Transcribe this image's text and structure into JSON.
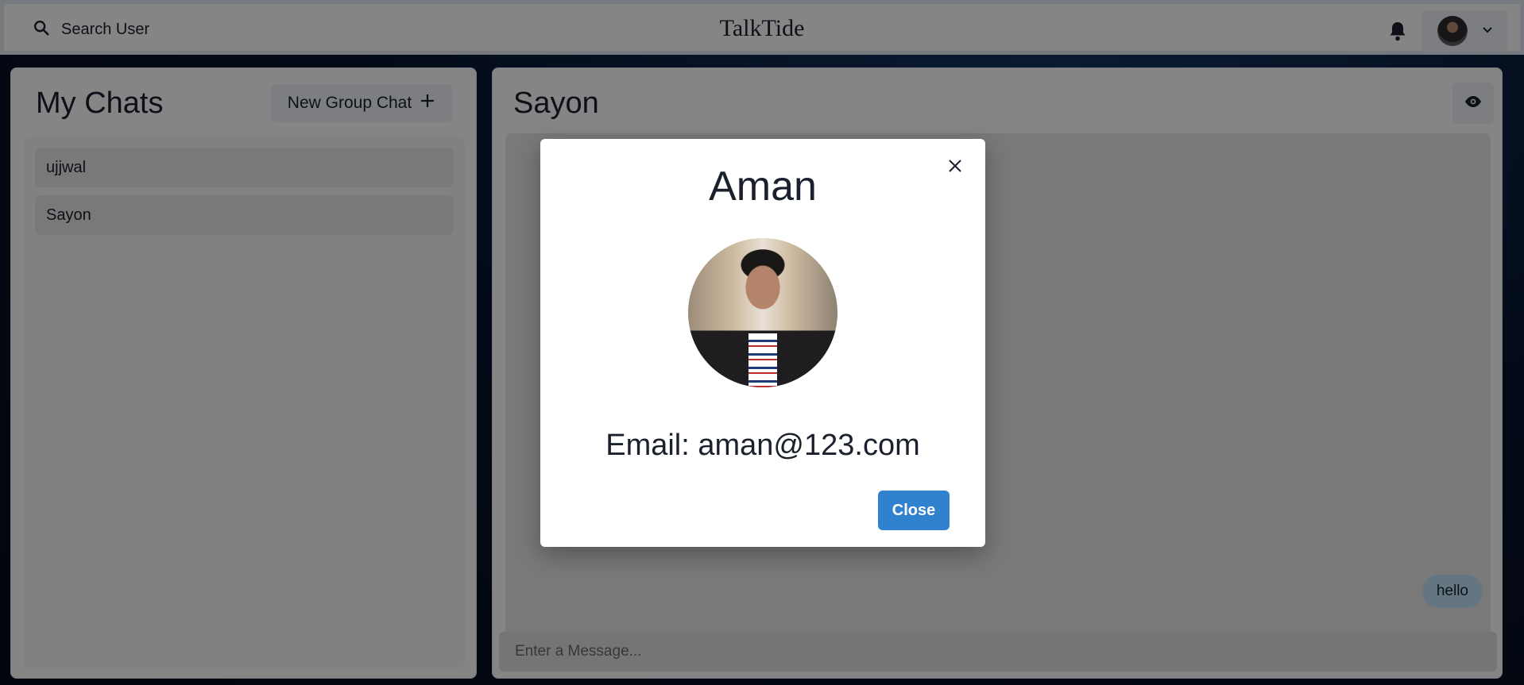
{
  "header": {
    "search_label": "Search User",
    "app_title": "TalkTide"
  },
  "sidebar": {
    "title": "My Chats",
    "new_group_label": "New Group Chat",
    "chats": [
      {
        "name": "ujjwal"
      },
      {
        "name": "Sayon"
      }
    ]
  },
  "chat": {
    "title": "Sayon",
    "messages": [
      {
        "text": "hello",
        "own": true
      }
    ],
    "input_placeholder": "Enter a Message..."
  },
  "modal": {
    "name": "Aman",
    "email": "Email: aman@123.com",
    "close_label": "Close"
  },
  "colors": {
    "primary_button": "#3182ce",
    "own_bubble": "#bee3f8"
  }
}
